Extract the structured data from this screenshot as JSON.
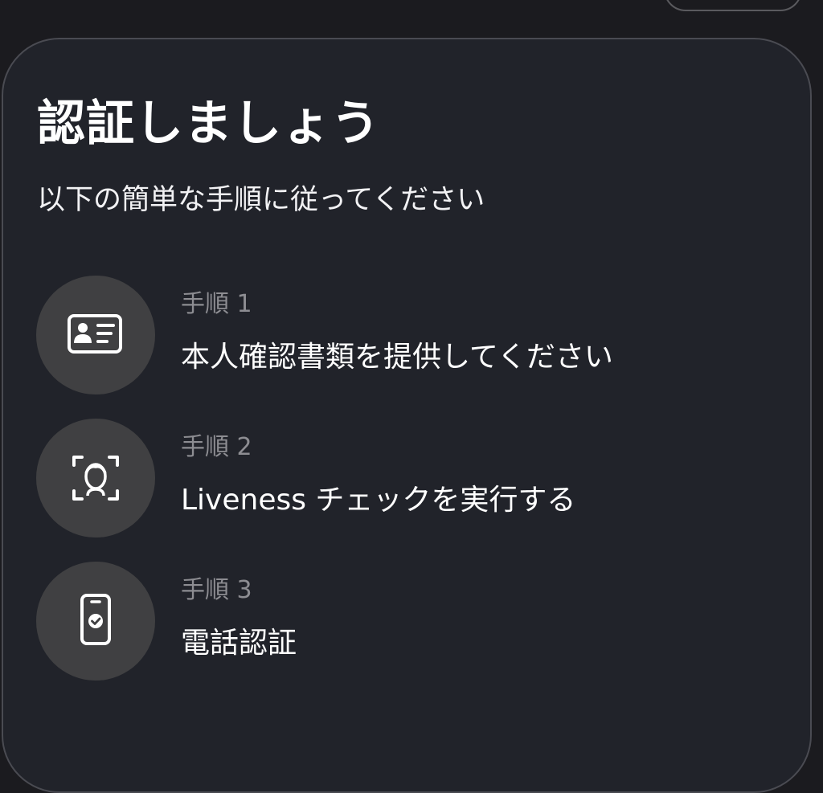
{
  "card": {
    "title": "認証しましょう",
    "subtitle": "以下の簡単な手順に従ってください"
  },
  "steps": [
    {
      "label": "手順 1",
      "text": "本人確認書類を提供してください",
      "icon": "id-card-icon"
    },
    {
      "label": "手順 2",
      "text": "Liveness チェックを実行する",
      "icon": "face-scan-icon"
    },
    {
      "label": "手順 3",
      "text": "電話認証",
      "icon": "phone-check-icon"
    }
  ]
}
